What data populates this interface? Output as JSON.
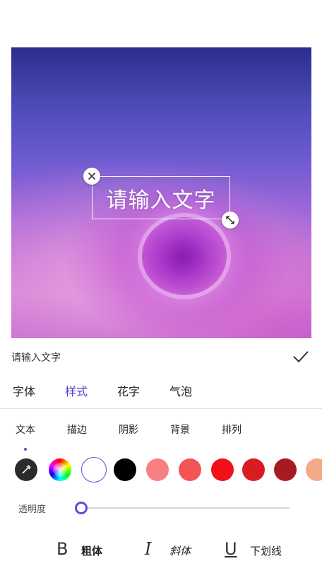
{
  "canvas": {
    "overlay_text": "请输入文字"
  },
  "caption": {
    "text": "请输入文字"
  },
  "tabs": [
    {
      "label": "字体",
      "active": false
    },
    {
      "label": "样式",
      "active": true
    },
    {
      "label": "花字",
      "active": false
    },
    {
      "label": "气泡",
      "active": false
    }
  ],
  "subtabs": [
    {
      "label": "文本"
    },
    {
      "label": "描边"
    },
    {
      "label": "阴影"
    },
    {
      "label": "背景"
    },
    {
      "label": "排列"
    }
  ],
  "colors": {
    "accent": "#4b3fcf",
    "swatches": [
      "#000000",
      "#f88080",
      "#f25456",
      "#f20f17",
      "#d81c22",
      "#a81a1f",
      "#f5a987"
    ]
  },
  "opacity": {
    "label": "透明度",
    "value": 0
  },
  "format": {
    "bold_icon": "B",
    "bold_label": "粗体",
    "italic_icon": "I",
    "italic_label": "斜体",
    "underline_icon": "U",
    "underline_label": "下划线"
  }
}
